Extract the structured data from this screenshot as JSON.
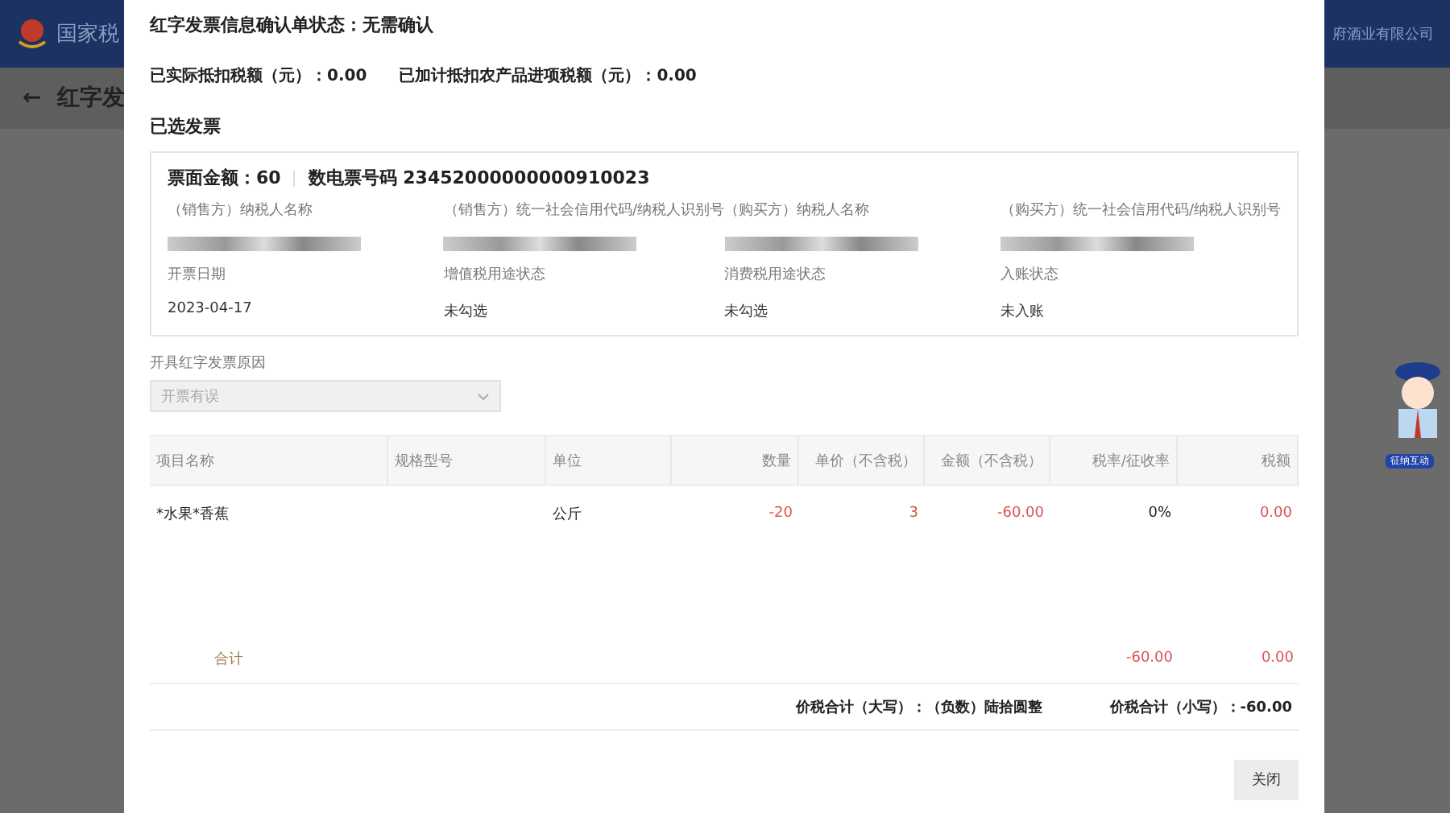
{
  "background": {
    "site_title": "国家税",
    "company": "府酒业有限公司",
    "back_arrow": "←",
    "page_title": "红字发",
    "assistant_badge": "征纳互动"
  },
  "modal": {
    "status_label": "红字发票信息确认单状态：",
    "status_value": "无需确认",
    "deductions": [
      {
        "label": "已实际抵扣税额（元）：",
        "value": "0.00"
      },
      {
        "label": "已加计抵扣农产品进项税额（元）：",
        "value": "0.00"
      }
    ],
    "section_title": "已选发票",
    "invoice": {
      "amount_label": "票面金额：",
      "amount": "60",
      "number_label": "数电票号码",
      "number": "23452000000000910023",
      "parties": [
        {
          "label": "（销售方）纳税人名称"
        },
        {
          "label": "（销售方）统一社会信用代码/纳税人识别号"
        },
        {
          "label": "（购买方）纳税人名称"
        },
        {
          "label": "（购买方）统一社会信用代码/纳税人识别号"
        }
      ],
      "details": [
        {
          "label": "开票日期",
          "value": "2023-04-17"
        },
        {
          "label": "增值税用途状态",
          "value": "未勾选"
        },
        {
          "label": "消费税用途状态",
          "value": "未勾选"
        },
        {
          "label": "入账状态",
          "value": "未入账"
        }
      ]
    },
    "reason": {
      "label": "开具红字发票原因",
      "value": "开票有误",
      "disabled": true
    },
    "table": {
      "columns": [
        "项目名称",
        "规格型号",
        "单位",
        "数量",
        "单价（不含税）",
        "金额（不含税）",
        "税率/征收率",
        "税额"
      ],
      "rows": [
        {
          "item_name": "*水果*香蕉",
          "unit": "公斤",
          "quantity": "-20",
          "unit_price": "3",
          "amount": "-60.00",
          "tax_rate": "0%",
          "tax": "0.00"
        }
      ],
      "total": {
        "label": "合计",
        "amount": "-60.00",
        "tax": "0.00"
      },
      "grand_total_upper_label": "价税合计（大写）：",
      "grand_total_upper": "（负数）陆拾圆整",
      "grand_total_lower_label": "价税合计（小写）：",
      "grand_total_lower": "-60.00"
    },
    "close_button": "关闭"
  }
}
